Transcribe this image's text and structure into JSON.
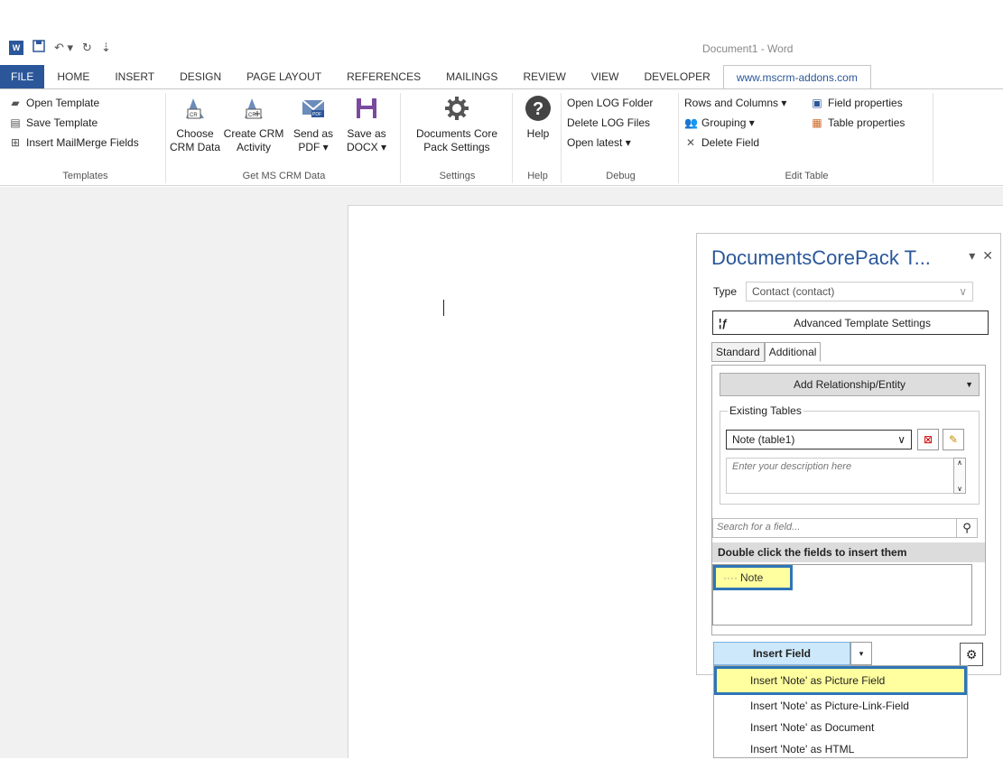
{
  "window": {
    "title": "Document1 - Word"
  },
  "quick_access": {
    "icons": [
      "word-icon",
      "save-icon",
      "undo-icon",
      "redo-icon",
      "customize-icon"
    ]
  },
  "tabs": [
    "FILE",
    "HOME",
    "INSERT",
    "DESIGN",
    "PAGE LAYOUT",
    "REFERENCES",
    "MAILINGS",
    "REVIEW",
    "VIEW",
    "DEVELOPER",
    "www.mscrm-addons.com"
  ],
  "ribbon": {
    "templates": {
      "open": "Open Template",
      "save": "Save Template",
      "insert_mailmerge": "Insert MailMerge Fields",
      "label": "Templates"
    },
    "get_data": {
      "choose": "Choose\nCRM Data",
      "create_activity": "Create CRM\nActivity",
      "send_pdf": "Send as\nPDF ▾",
      "save_docx": "Save as\nDOCX ▾",
      "label": "Get MS CRM Data"
    },
    "settings": {
      "dcp": "Documents Core\nPack Settings",
      "label": "Settings"
    },
    "help": {
      "help": "Help",
      "label": "Help"
    },
    "debug": {
      "open_log": "Open LOG Folder",
      "delete_log": "Delete LOG Files",
      "open_latest": "Open latest ▾",
      "label": "Debug"
    },
    "edit_table": {
      "rows_cols": "Rows and Columns ▾",
      "grouping": "Grouping ▾",
      "delete_field": "Delete Field",
      "field_props": "Field properties",
      "table_props": "Table properties",
      "label": "Edit Table"
    }
  },
  "pane": {
    "title": "DocumentsCorePack T...",
    "type_label": "Type",
    "type_value": "Contact (contact)",
    "advanced": "Advanced Template Settings",
    "tab_standard": "Standard",
    "tab_additional": "Additional",
    "add_relationship": "Add Relationship/Entity",
    "existing_tables": "Existing Tables",
    "table_selected": "Note  (table1)",
    "description_placeholder": "Enter your description here",
    "search_placeholder": "Search for a field...",
    "double_click": "Double click the fields to insert them",
    "field": "Note"
  },
  "insert": {
    "button": "Insert Field",
    "menu": [
      "Insert 'Note' as Picture Field",
      "Insert 'Note' as Picture-Link-Field",
      "Insert 'Note' as Document",
      "Insert 'Note' as HTML"
    ]
  },
  "colors": {
    "accent": "#2b579a",
    "highlight": "#ffff9f",
    "callout": "#2e75b6",
    "button": "#cde8fa"
  }
}
